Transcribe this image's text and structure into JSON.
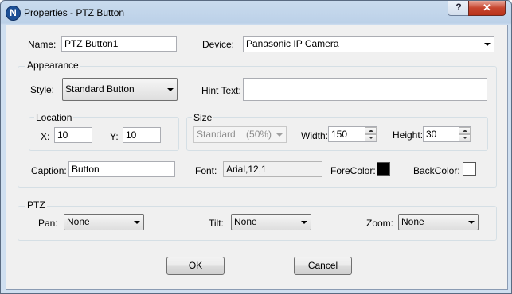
{
  "window": {
    "title": "Properties - PTZ Button",
    "app_icon_letter": "N",
    "help_label": "?",
    "close_label": "✕"
  },
  "general": {
    "name_label": "Name:",
    "name_value": "PTZ Button1",
    "device_label": "Device:",
    "device_value": "Panasonic IP Camera"
  },
  "appearance": {
    "group_label": "Appearance",
    "style_label": "Style:",
    "style_value": "Standard Button",
    "hint_label": "Hint Text:",
    "hint_value": "",
    "location": {
      "group_label": "Location",
      "x_label": "X:",
      "x_value": "10",
      "y_label": "Y:",
      "y_value": "10"
    },
    "size": {
      "group_label": "Size",
      "preset_value": "Standard    (50%)",
      "width_label": "Width:",
      "width_value": "150",
      "height_label": "Height:",
      "height_value": "30"
    },
    "caption_label": "Caption:",
    "caption_value": "Button",
    "font_label": "Font:",
    "font_value": "Arial,12,1",
    "forecolor_label": "ForeColor:",
    "forecolor": "#000000",
    "backcolor_label": "BackColor:",
    "backcolor": "#ffffff"
  },
  "ptz": {
    "group_label": "PTZ",
    "pan_label": "Pan:",
    "pan_value": "None",
    "tilt_label": "Tilt:",
    "tilt_value": "None",
    "zoom_label": "Zoom:",
    "zoom_value": "None"
  },
  "buttons": {
    "ok_label": "OK",
    "cancel_label": "Cancel"
  },
  "icons": [
    "app-icon",
    "help-icon",
    "close-icon",
    "dropdown-arrow-icon",
    "spin-up-icon",
    "spin-down-icon"
  ]
}
